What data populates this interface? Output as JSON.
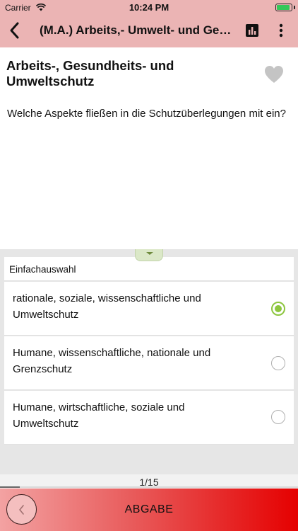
{
  "status_bar": {
    "carrier": "Carrier",
    "time": "10:24 PM"
  },
  "nav": {
    "title": "(M.A.) Arbeits,- Umwelt- und Ges…"
  },
  "question": {
    "category": "Arbeits-, Gesundheits- und Umweltschutz",
    "text": "Welche Aspekte fließen in die Schutzüberlegungen mit ein?",
    "favorite": false
  },
  "answers": {
    "type_label": "Einfachauswahl",
    "options": [
      {
        "label": "rationale, soziale, wissenschaftliche und Umweltschutz",
        "selected": true
      },
      {
        "label": "Humane, wissenschaftliche, nationale und Grenzschutz",
        "selected": false
      },
      {
        "label": "Humane, wirtschaftliche, soziale und Umweltschutz",
        "selected": false
      }
    ]
  },
  "progress": {
    "counter": "1/15",
    "current": 1,
    "total": 15
  },
  "footer": {
    "submit_label": "ABGABE"
  },
  "colors": {
    "header": "#ebb4b4",
    "accent_green": "#8dc63f",
    "bottom_red": "#e50000"
  },
  "icons": [
    "wifi-icon",
    "battery-icon",
    "back-chevron-icon",
    "stats-icon",
    "more-vertical-icon",
    "heart-icon",
    "expand-handle-icon",
    "prev-chevron-icon"
  ]
}
